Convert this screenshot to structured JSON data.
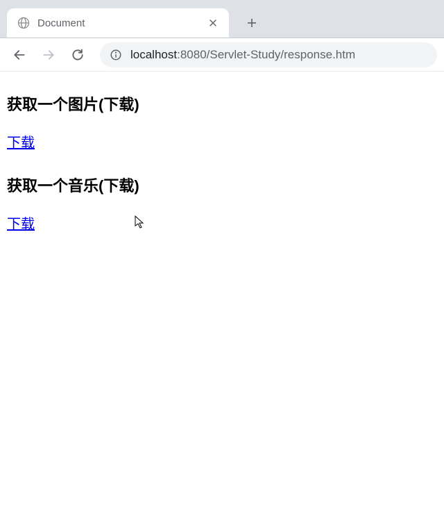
{
  "tab": {
    "title": "Document"
  },
  "url": {
    "host": "localhost",
    "port": ":8080",
    "path": "/Servlet-Study/response.htm"
  },
  "page": {
    "heading1": "获取一个图片(下载)",
    "link1": "下载",
    "heading2": "获取一个音乐(下载)",
    "link2": "下载"
  }
}
